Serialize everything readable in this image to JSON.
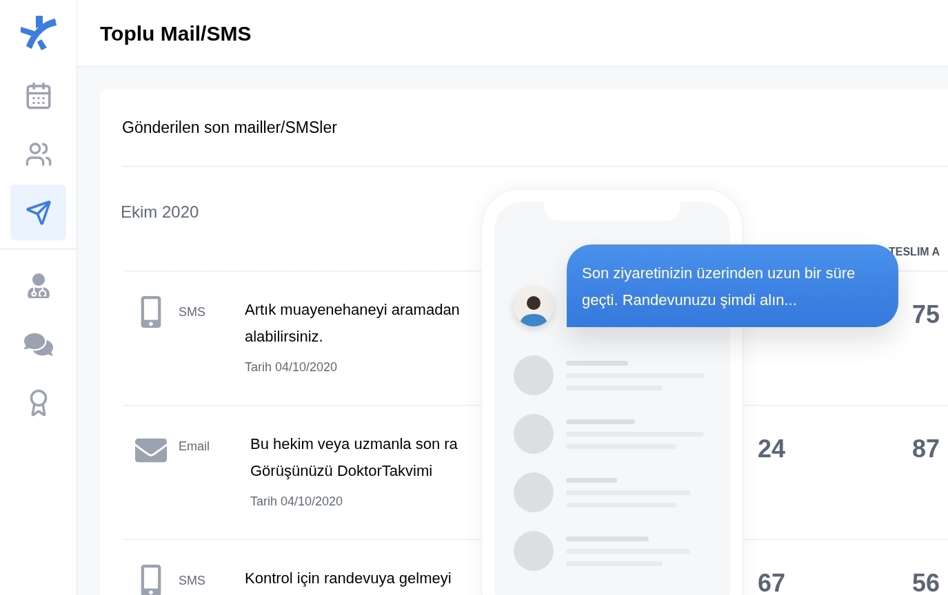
{
  "header": {
    "title": "Toplu Mail/SMS"
  },
  "sidebar": {
    "items": [
      {
        "selected": false
      },
      {
        "selected": false
      },
      {
        "selected": true
      },
      {
        "selected": false
      },
      {
        "selected": false
      },
      {
        "selected": false
      }
    ]
  },
  "card": {
    "title": "Gönderilen son mailler/SMSler",
    "month": "Ekim 2020",
    "columns": [
      {
        "label": "TESLIM A"
      }
    ],
    "rows": [
      {
        "kind": "sms",
        "type": "SMS",
        "message": [
          "Artık muayenehaneyi aramadan",
          "alabilirsiniz."
        ],
        "date": "Tarih 04/10/2020",
        "rate": "75"
      },
      {
        "kind": "email",
        "type": "Email",
        "message": [
          "Bu hekim veya uzmanla son ra",
          "Görüşünüzü DoktorTakvimi"
        ],
        "date": "Tarih 04/10/2020",
        "count": "24",
        "rate": "87"
      },
      {
        "kind": "sms",
        "type": "SMS",
        "message": [
          "Kontrol için randevuya gelmeyi"
        ],
        "count": "67",
        "rate": "56"
      }
    ]
  },
  "phone": {
    "bubble": "Son ziyaretinizin üzerinden uzun bir süre geçti. Randevunuzu şimdi alın..."
  }
}
